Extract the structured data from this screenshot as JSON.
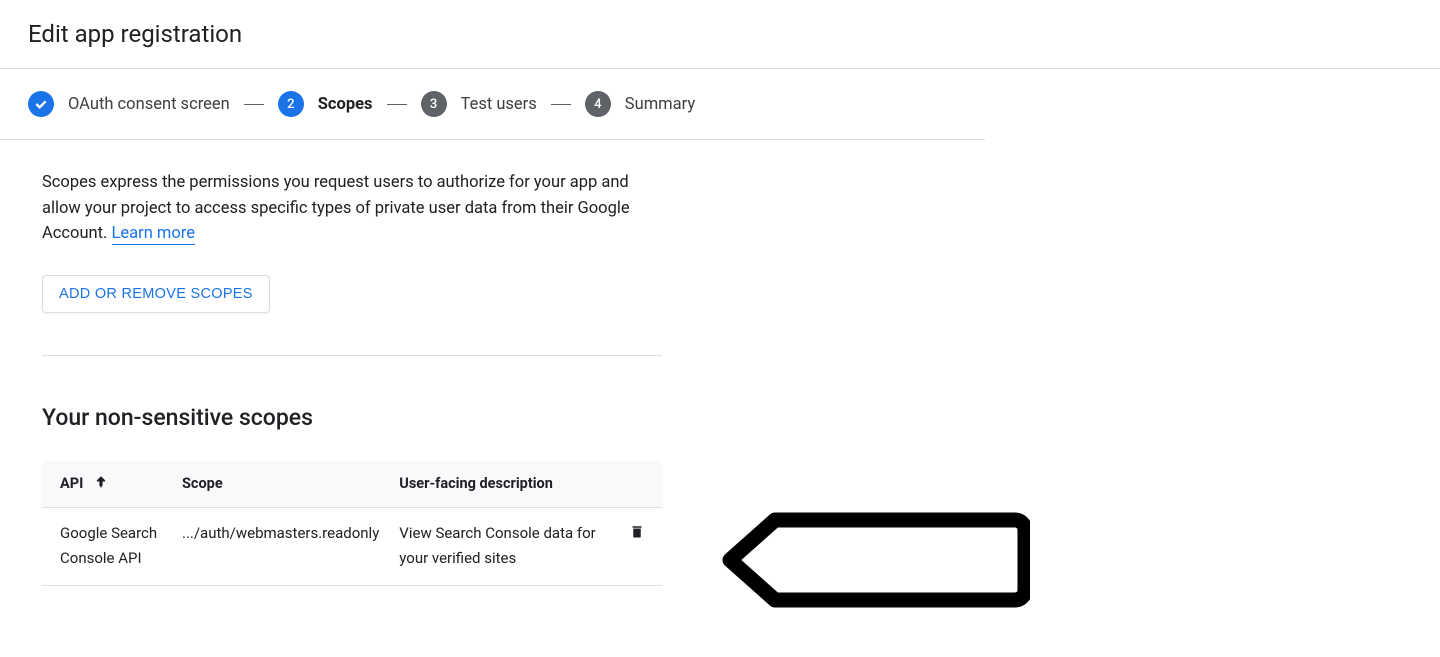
{
  "page": {
    "title": "Edit app registration"
  },
  "stepper": {
    "steps": [
      {
        "label": "OAuth consent screen"
      },
      {
        "number": "2",
        "label": "Scopes"
      },
      {
        "number": "3",
        "label": "Test users"
      },
      {
        "number": "4",
        "label": "Summary"
      }
    ]
  },
  "description": {
    "text": "Scopes express the permissions you request users to authorize for your app and allow your project to access specific types of private user data from their Google Account. ",
    "learn_more": "Learn more"
  },
  "buttons": {
    "add_remove_scopes": "ADD OR REMOVE SCOPES"
  },
  "section": {
    "title": "Your non-sensitive scopes"
  },
  "table": {
    "headers": {
      "api": "API",
      "scope": "Scope",
      "description": "User-facing description"
    },
    "rows": [
      {
        "api": "Google Search Console API",
        "scope": ".../auth/webmasters.readonly",
        "description": "View Search Console data for your verified sites"
      }
    ]
  }
}
